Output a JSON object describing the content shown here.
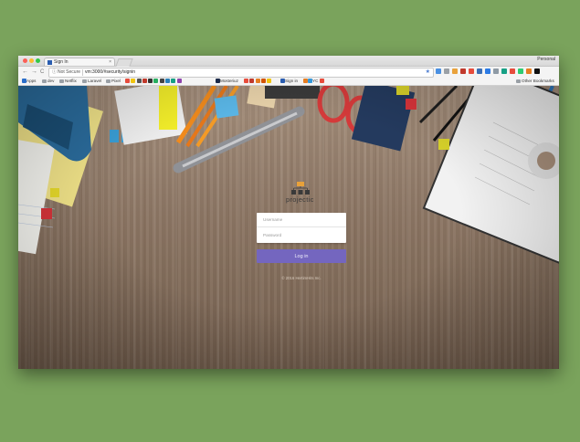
{
  "browser": {
    "tab_title": "Sign In",
    "tab_close": "×",
    "profile_name": "Personal",
    "security_label": "Not Secure",
    "url": "vm:3000/#security/signin",
    "nav": {
      "back": "←",
      "forward": "→",
      "reload": "C"
    },
    "info_icon": "ⓘ",
    "star": "★",
    "bookmarks": [
      "Apps",
      "dev",
      "Netflix",
      "Laravel",
      "Pixel",
      "Mosteriuz",
      "Sign in",
      "YC",
      "Other Bookmarks"
    ],
    "extension_colors": [
      "#4a90e2",
      "#9aa0a6",
      "#e9a23b",
      "#c0392b",
      "#e74c3c",
      "#3b6fb6",
      "#2c7be5",
      "#8e9aa5",
      "#16a085",
      "#e74c3c",
      "#2ecc71",
      "#e67e22",
      "#111111"
    ]
  },
  "login": {
    "logo_text": "projectic",
    "username_placeholder": "Username",
    "password_placeholder": "Password",
    "login_button": "Log in",
    "copyright": "© 2016 HertimHits Inc."
  },
  "colors": {
    "page_bg": "#7aa35c",
    "button": "#7466bf"
  }
}
